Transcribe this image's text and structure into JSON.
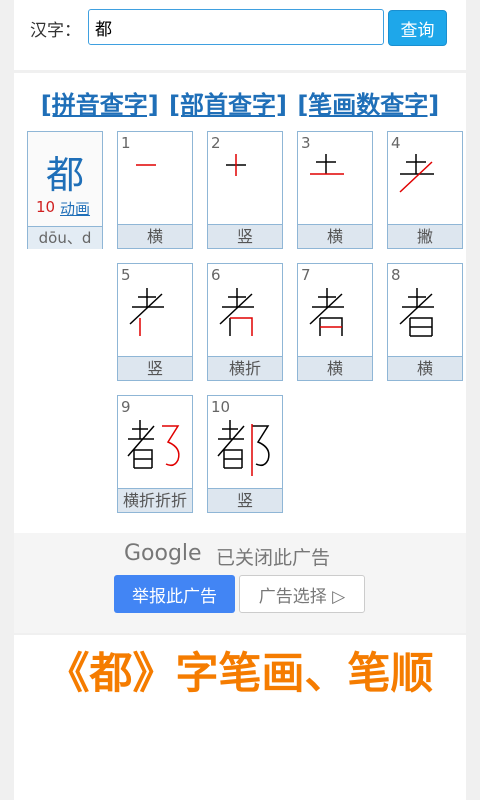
{
  "search": {
    "label": "汉字：",
    "value": "都",
    "button": "查询"
  },
  "lookup_links": [
    "[拼音查字]",
    "[部首查字]",
    "[笔画数查字]"
  ],
  "character": {
    "glyph": "都",
    "stroke_count": "10",
    "animate_label": "动画",
    "pinyin": "dōu、d"
  },
  "strokes": [
    {
      "number": "1",
      "name": "横"
    },
    {
      "number": "2",
      "name": "竖"
    },
    {
      "number": "3",
      "name": "横"
    },
    {
      "number": "4",
      "name": "撇"
    },
    {
      "number": "5",
      "name": "竖"
    },
    {
      "number": "6",
      "name": "横折"
    },
    {
      "number": "7",
      "name": "横"
    },
    {
      "number": "8",
      "name": "横"
    },
    {
      "number": "9",
      "name": "横折折折"
    },
    {
      "number": "10",
      "name": "竖"
    }
  ],
  "ad": {
    "brand": "Google",
    "status": "已关闭此广告",
    "report_button": "举报此广告",
    "choice_button": "广告选择 ▷"
  },
  "article": {
    "title": "《都》字笔画、笔顺"
  },
  "colors": {
    "accent": "#1f6fb8",
    "button": "#1ea7ea",
    "stroke_highlight": "#e00000",
    "title": "#f57c00"
  }
}
